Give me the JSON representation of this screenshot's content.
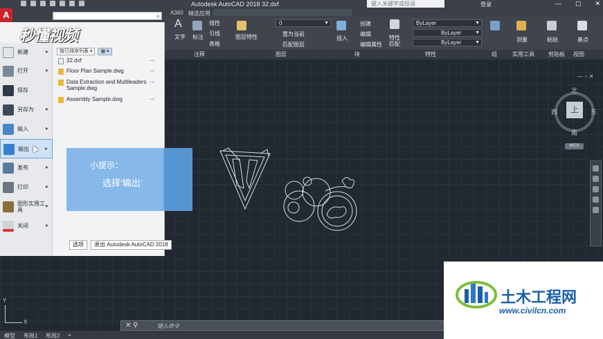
{
  "titlebar": {
    "title": "Autodesk AutoCAD 2018    32.dxf",
    "search_placeholder": "键入关键字或短语",
    "login": "登录",
    "buttons": [
      "—",
      "▢",
      "✕"
    ]
  },
  "tabs": [
    "A360",
    "精选应用"
  ],
  "ribbon": {
    "annotation": {
      "text": "文字",
      "dim": "标注",
      "line": "线性",
      "leader": "引线",
      "table": "表格",
      "group_label": "注释"
    },
    "layers": {
      "props": "图层特性",
      "layer_value": "0",
      "set_current": "置为当前",
      "match": "匹配图层",
      "group_label": "图层"
    },
    "block": {
      "insert": "插入",
      "create": "创建",
      "edit": "编辑",
      "edit_attr": "编辑属性",
      "group_label": "块"
    },
    "properties": {
      "match": "特性匹配",
      "bylayer1": "ByLayer",
      "bylayer2": "ByLayer",
      "bylayer3": "ByLayer",
      "group_label": "特性"
    },
    "groups": {
      "group_label": "组"
    },
    "utilities": {
      "measure": "测量",
      "group_label": "实用工具"
    },
    "clipboard": {
      "paste": "粘贴",
      "group_label": "剪贴板"
    },
    "view": {
      "base": "基点",
      "group_label": "视图"
    }
  },
  "appmenu": {
    "logo": "秒懂视频",
    "items": [
      {
        "label": "新建"
      },
      {
        "label": "打开"
      },
      {
        "label": "保存"
      },
      {
        "label": "另存为"
      },
      {
        "label": "输入"
      },
      {
        "label": "输出"
      },
      {
        "label": "发布"
      },
      {
        "label": "打印"
      },
      {
        "label": "图形实用工具"
      },
      {
        "label": "关闭"
      }
    ],
    "recent_sort": "按已排序列表",
    "recent": [
      "32.dxf",
      "Floor Plan Sample.dwg",
      "Data Extraction and Multileaders Sample.dwg",
      "Assembly Sample.dwg"
    ],
    "options_btn": "选项",
    "exit_btn": "退出 Autodesk AutoCAD 2018"
  },
  "hint": {
    "title": "小提示：",
    "body": "选择‘输出’"
  },
  "viewcube": {
    "north": "北",
    "south": "南",
    "east": "东",
    "west": "西",
    "top": "上",
    "wcs": "WCS"
  },
  "cmdline": {
    "placeholder": "键入命令"
  },
  "status": {
    "tabs": [
      "模型",
      "布局1",
      "布局2",
      "+"
    ]
  },
  "ucs": {
    "x": "X",
    "y": "Y"
  },
  "watermark": {
    "title": "土木工程网",
    "url": "www.civilcn.com"
  }
}
